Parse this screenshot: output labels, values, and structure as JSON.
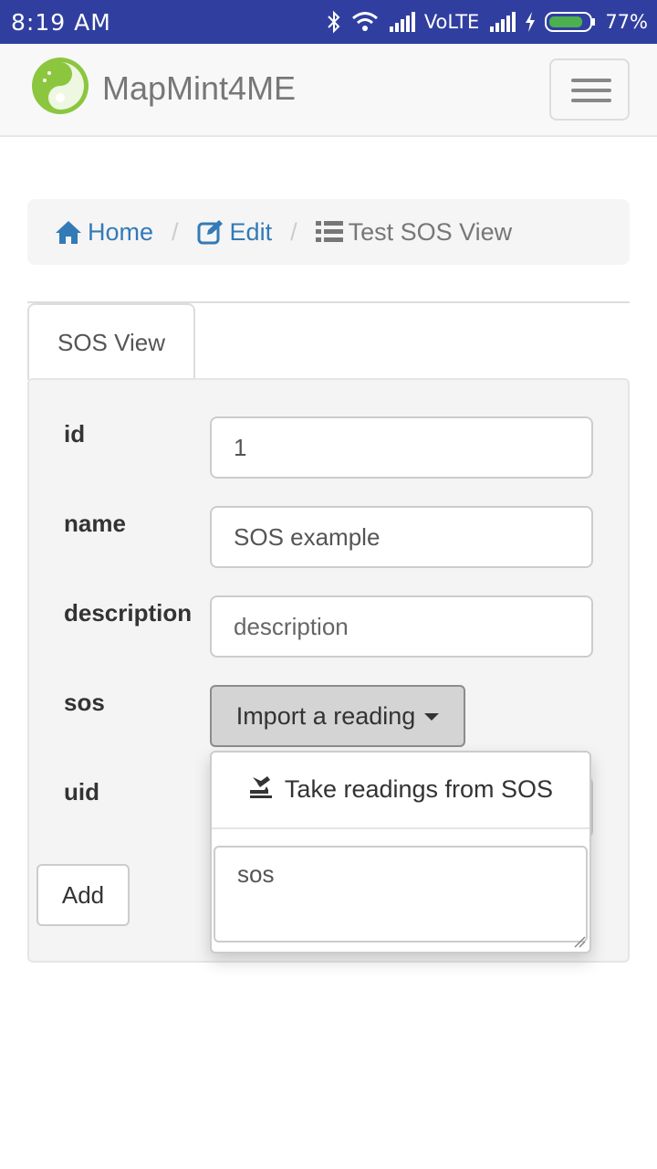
{
  "status_bar": {
    "time": "8:19 AM",
    "network": "VoLTE",
    "battery": "77%"
  },
  "navbar": {
    "brand": "MapMint4ME"
  },
  "breadcrumb": {
    "home": "Home",
    "edit": "Edit",
    "current": "Test SOS View",
    "separator": "/"
  },
  "tabs": [
    {
      "label": "SOS View"
    }
  ],
  "form": {
    "fields": [
      {
        "label": "id",
        "value": "1"
      },
      {
        "label": "name",
        "value": "SOS example"
      },
      {
        "label": "description",
        "placeholder": "description"
      },
      {
        "label": "sos"
      },
      {
        "label": "uid"
      }
    ],
    "import_button": "Import a reading",
    "add_button": "Add"
  },
  "dropdown": {
    "item": "Take readings from SOS",
    "textarea_placeholder": "sos"
  },
  "colors": {
    "status_bar": "#303f9f",
    "link": "#337ab7",
    "logo": "#8cc63f"
  }
}
